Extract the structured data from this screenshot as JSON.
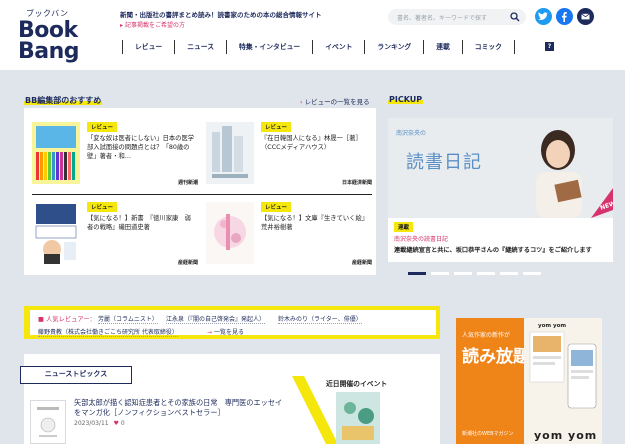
{
  "header": {
    "logo_kana": "ブックバン",
    "logo_line1": "Book",
    "logo_line2": "Bang",
    "tagline": "新聞・出版社の書評まとめ読み！読書家のための本の総合情報サイト",
    "recruit": "記事掲載をご希望の方",
    "search_placeholder": "書名、著者名、キーワードで探す",
    "nav": [
      "レビュー",
      "ニュース",
      "特集・インタビュー",
      "イベント",
      "ランキング",
      "連載",
      "コミック"
    ],
    "help_label": "?"
  },
  "picks": {
    "title": "BB編集部のおすすめ",
    "more": "レビューの一覧を見る",
    "cards": [
      {
        "badge": "レビュー",
        "title": "「変な奴は医者にしない」日本の医学部入試面接の問題点とは？「80歳の壁」著者・和…",
        "source": "週刊新潮"
      },
      {
        "badge": "レビュー",
        "title": "『在日韓国人になる』林晟一［著］（CCCメディアハウス）",
        "source": "日本経済新聞"
      },
      {
        "badge": "レビュー",
        "title": "【気になる！】新書　『徳川家康　弱者の戦略』磯田道史著",
        "source": "産経新聞"
      },
      {
        "badge": "レビュー",
        "title": "【気になる！】文庫『生きていく絵』荒井裕樹著",
        "source": "産経新聞"
      }
    ]
  },
  "pickup": {
    "title": "PICKUP",
    "image_label": "南沢奈央の",
    "image_big": "読書日記",
    "new_label": "NEW",
    "badge": "連載",
    "sub": "南沢奈央の読書日記",
    "desc": "連載継続宣言と共に、坂口恭平さんの『継続するコツ』をご紹介します"
  },
  "reviewers": {
    "label": "■ 人気レビュアー：",
    "names": [
      "芳麗（コラムニスト）",
      "江永泉（『闇の自己啓発会』発起人）",
      "鈴木みのり（ライター、俳優）",
      "藤野貴教（株式会社働きごこち研究所 代表取締役）"
    ],
    "more": "一覧を見る"
  },
  "news": {
    "head": "ニューストピックス",
    "item_title": "矢部太郎が描く認知症患者とその家族の日常　専門医のエッセイをマンガ化［ノンフィクションベストセラー］",
    "item_date": "2023/03/11",
    "item_count": "0",
    "events_title": "近日開催のイベント"
  },
  "ad": {
    "small": "人気作家の新作が",
    "big": "読み放題",
    "brand": "yom yom",
    "brand_big": "yom yom",
    "mini": "新潮社のWEBマガジン"
  },
  "colors": {
    "navy": "#1d2a5c",
    "accent_yellow": "#f5e60c",
    "accent_pink": "#d6336c"
  }
}
